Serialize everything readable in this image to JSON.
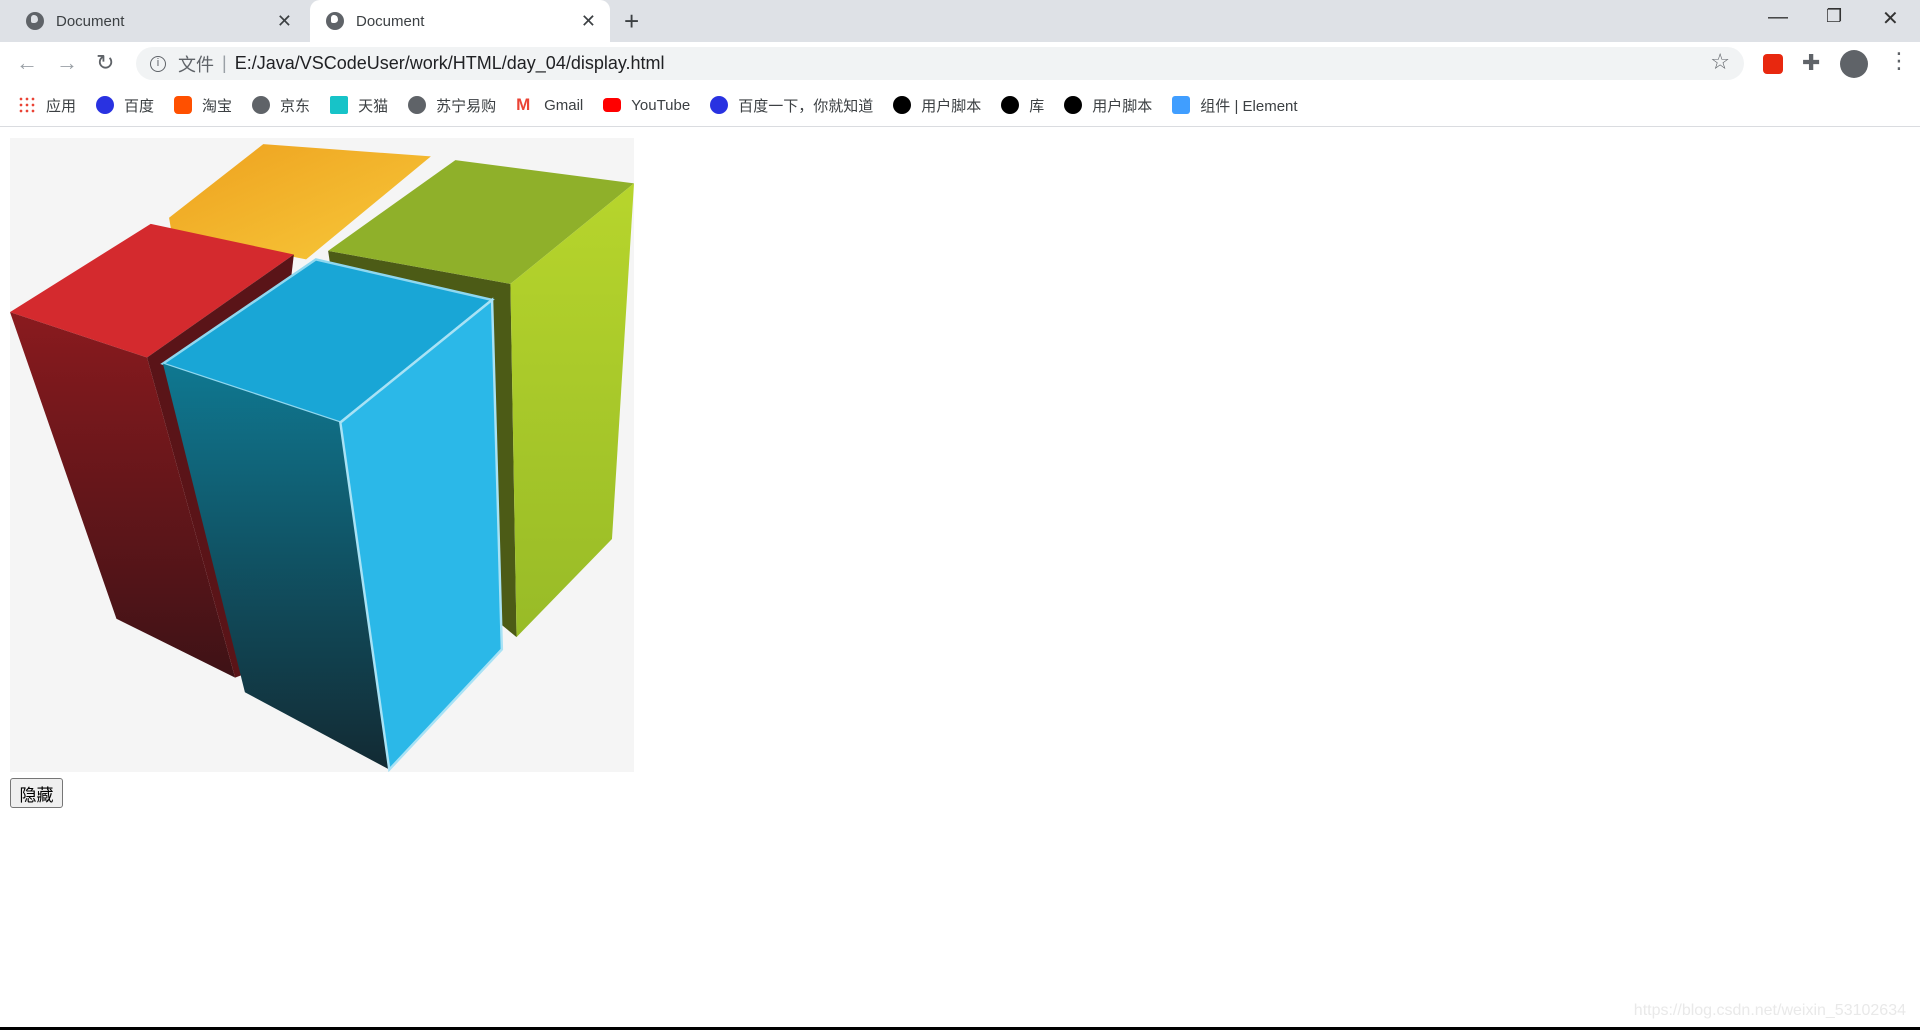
{
  "tabs": [
    {
      "title": "Document",
      "active": false
    },
    {
      "title": "Document",
      "active": true
    }
  ],
  "address": {
    "scheme_label": "文件",
    "url": "E:/Java/VSCodeUser/work/HTML/day_04/display.html"
  },
  "bookmarks": [
    {
      "label": "应用",
      "icon": "apps-grid-icon"
    },
    {
      "label": "百度",
      "icon": "baidu-paw-icon"
    },
    {
      "label": "淘宝",
      "icon": "taobao-icon"
    },
    {
      "label": "京东",
      "icon": "globe-icon"
    },
    {
      "label": "天猫",
      "icon": "tmall-icon"
    },
    {
      "label": "苏宁易购",
      "icon": "globe-icon"
    },
    {
      "label": "Gmail",
      "icon": "gmail-icon"
    },
    {
      "label": "YouTube",
      "icon": "youtube-icon"
    },
    {
      "label": "百度一下，你就知道",
      "icon": "baidu-paw-icon"
    },
    {
      "label": "用户脚本",
      "icon": "greasyfork-icon"
    },
    {
      "label": "库",
      "icon": "greasyfork-icon"
    },
    {
      "label": "用户脚本",
      "icon": "greasyfork-icon"
    },
    {
      "label": "组件 | Element",
      "icon": "element-icon"
    }
  ],
  "page": {
    "button_label": "隐藏",
    "watermark": "https://blog.csdn.net/weixin_53102634"
  },
  "colors": {
    "red": "#d42a2e",
    "yellow": "#f3b527",
    "green": "#9cc12a",
    "blue": "#2bb8e8"
  }
}
